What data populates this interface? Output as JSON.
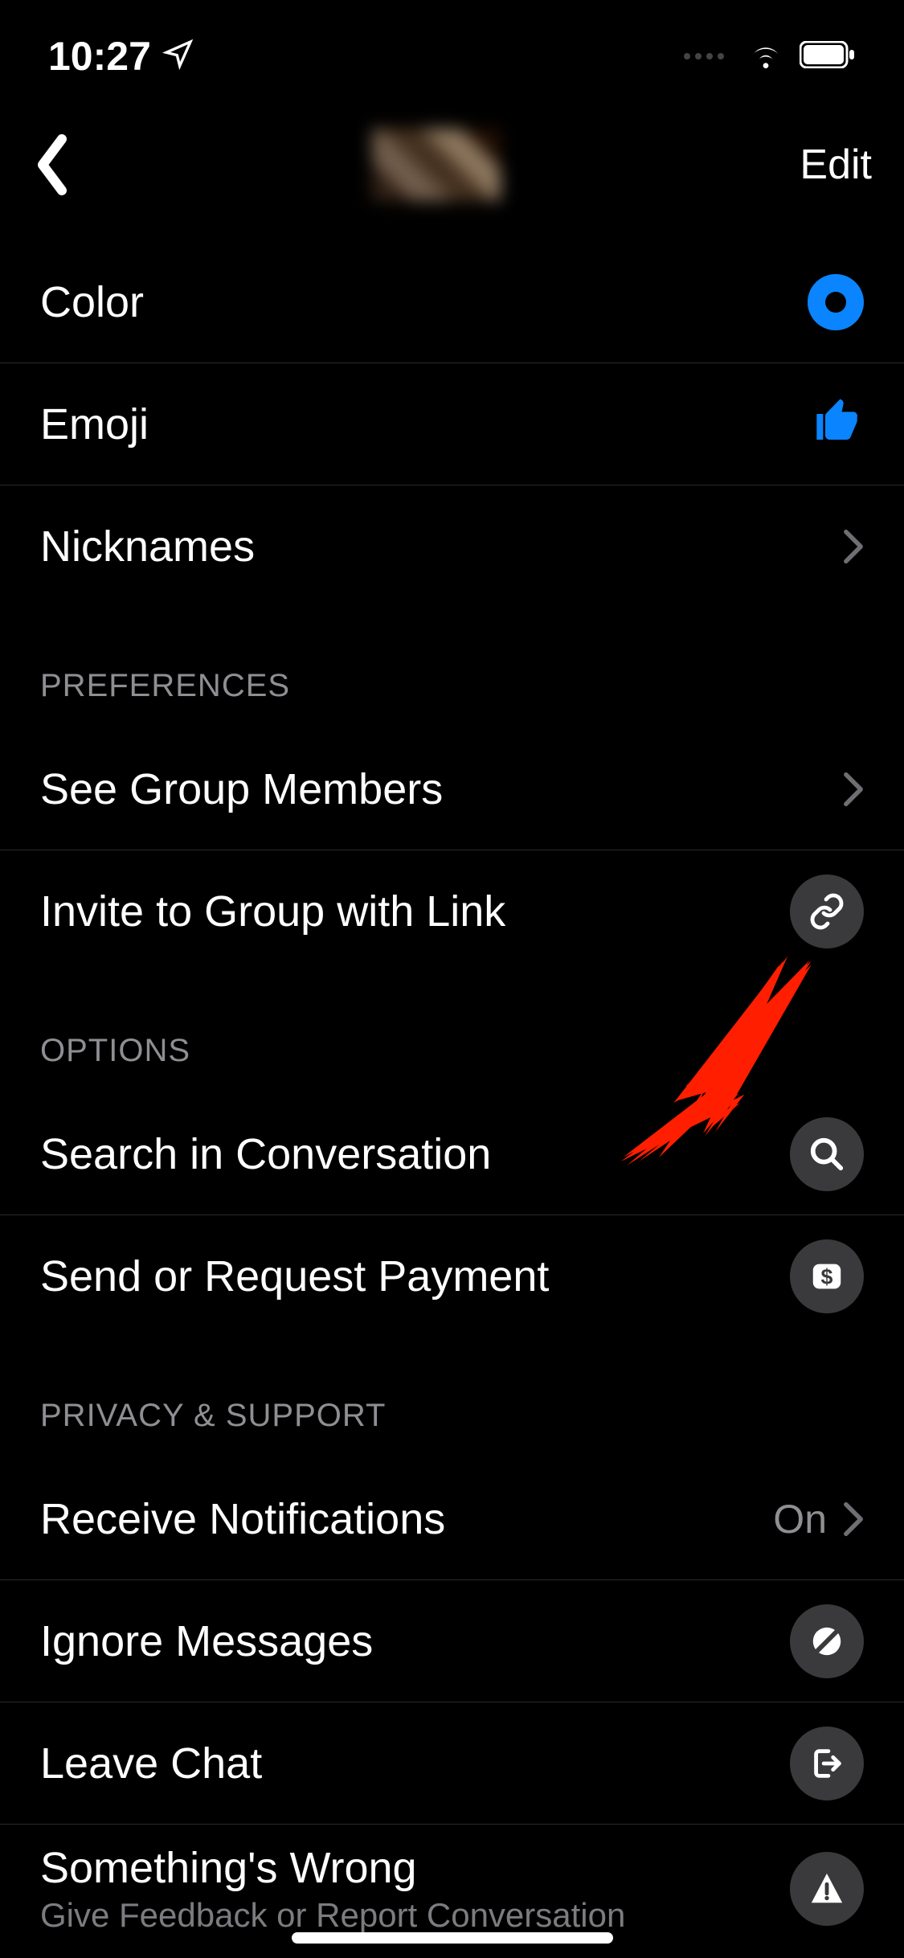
{
  "status": {
    "time": "10:27"
  },
  "nav": {
    "edit": "Edit"
  },
  "rows": {
    "color": "Color",
    "emoji": "Emoji",
    "nicknames": "Nicknames"
  },
  "sections": {
    "preferences": "PREFERENCES",
    "options": "OPTIONS",
    "privacy": "PRIVACY & SUPPORT"
  },
  "preferences": {
    "members": "See Group Members",
    "invite": "Invite to Group with Link"
  },
  "options": {
    "search": "Search in Conversation",
    "payment": "Send or Request Payment"
  },
  "privacy": {
    "notifications": "Receive Notifications",
    "notifications_value": "On",
    "ignore": "Ignore Messages",
    "leave": "Leave Chat",
    "wrong": "Something's Wrong",
    "wrong_sub": "Give Feedback or Report Conversation"
  }
}
